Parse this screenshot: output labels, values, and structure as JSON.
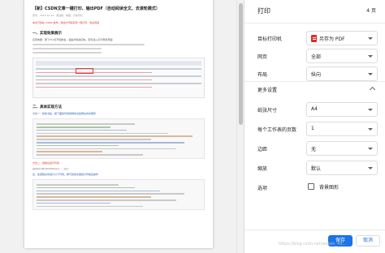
{
  "preview": {
    "doc_title": "【新】CSDN文章一键打印、输出PDF（自动阅读全文、去滚轮模式）",
    "doc_meta": "原创 · 2019-10-10 · 阅读数 · 收藏 · 分类专栏",
    "doc_notice": "本文已经在 CSDN 发布，通过JS代码实现一键打印，欢迎转载",
    "section1": "一、实现效果展示",
    "line1": "实现效果：按下F12打开控制台，粘贴代码并回车，即可进入打印预览界面",
    "section2": "二、具体实现方法",
    "line2": "方法一：新建书签，把下面的代码复制到书签网址中并保存",
    "line3": "javascript:(function(){ ... })();",
    "line4": "方法二：控制台运行代码",
    "line5": "注：在控制台中运行以下代码，即可完成文章的打印输出操作"
  },
  "settings": {
    "title": "打印",
    "page_count": "4 页",
    "destination_label": "目标打印机",
    "destination_value": "另存为 PDF",
    "pages_label": "网页",
    "pages_value": "全部",
    "layout_label": "布局",
    "layout_value": "纵向",
    "more_label": "更多设置",
    "paper_label": "纸张尺寸",
    "paper_value": "A4",
    "pps_label": "每个工作表的页数",
    "pps_value": "1",
    "margins_label": "边距",
    "margins_value": "无",
    "scale_label": "缩放",
    "scale_value": "默认",
    "options_label": "选项",
    "bg_graphics_label": "背景图形",
    "save_label": "保存",
    "cancel_label": "取消",
    "watermark": "https://blog.csdn.net/weixin_43..."
  },
  "colors": {
    "accent": "#1a73e8",
    "pdf_icon": "#d93025"
  }
}
